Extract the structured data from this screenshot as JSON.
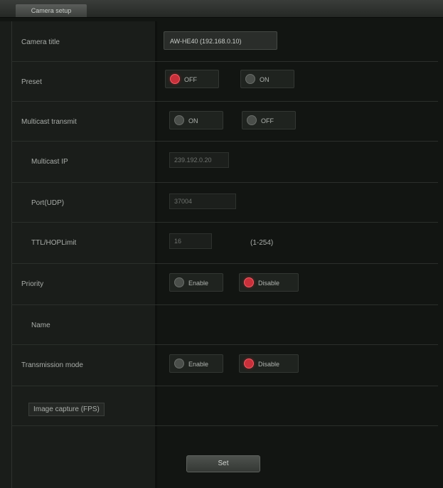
{
  "header": {
    "tab_label": "Camera setup"
  },
  "rows": {
    "camera_title": {
      "label": "Camera title",
      "value": "AW-HE40 (192.168.0.10)"
    },
    "preset": {
      "label": "Preset",
      "options": [
        "OFF",
        "ON"
      ],
      "selected": 0
    },
    "multicast": {
      "label": "Multicast transmit",
      "options": [
        "ON",
        "OFF"
      ],
      "selected": -1
    },
    "multicast_address": {
      "label": "Multicast IP",
      "value": "239.192.0.20"
    },
    "multicast_port": {
      "label": "Port(UDP)",
      "value": "37004"
    },
    "multicast_ttl": {
      "label": "TTL/HOPLimit",
      "value": "16",
      "range": "(1-254)"
    },
    "priority": {
      "label": "Priority",
      "options": [
        "Enable",
        "Disable"
      ],
      "selected": 1
    },
    "name": {
      "label": "Name"
    },
    "quality": {
      "label": "Transmission mode",
      "options": [
        "Enable",
        "Disable"
      ],
      "selected": 1
    },
    "quality_detail": {
      "label": "Image capture (FPS)"
    }
  },
  "footer": {
    "set_label": "Set"
  },
  "colors": {
    "accent_on": "#c8303a",
    "background": "#121512"
  }
}
